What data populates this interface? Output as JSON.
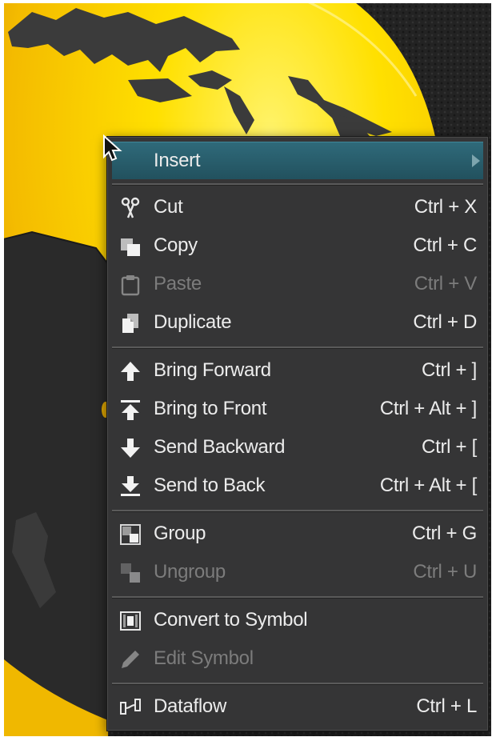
{
  "menu": {
    "insert": {
      "label": "Insert",
      "icon": "submenu-arrow-icon"
    },
    "cut": {
      "label": "Cut",
      "shortcut": "Ctrl + X",
      "icon": "scissors-icon"
    },
    "copy": {
      "label": "Copy",
      "shortcut": "Ctrl + C",
      "icon": "copy-icon"
    },
    "paste": {
      "label": "Paste",
      "shortcut": "Ctrl + V",
      "icon": "clipboard-icon",
      "disabled": true
    },
    "duplicate": {
      "label": "Duplicate",
      "shortcut": "Ctrl + D",
      "icon": "duplicate-icon"
    },
    "bring_forward": {
      "label": "Bring Forward",
      "shortcut": "Ctrl + ]",
      "icon": "arrow-up-icon"
    },
    "bring_to_front": {
      "label": "Bring to Front",
      "shortcut": "Ctrl + Alt + ]",
      "icon": "arrow-up-to-top-icon"
    },
    "send_backward": {
      "label": "Send Backward",
      "shortcut": "Ctrl + [",
      "icon": "arrow-down-icon"
    },
    "send_to_back": {
      "label": "Send to Back",
      "shortcut": "Ctrl + Alt + [",
      "icon": "arrow-down-to-bottom-icon"
    },
    "group": {
      "label": "Group",
      "shortcut": "Ctrl + G",
      "icon": "group-icon"
    },
    "ungroup": {
      "label": "Ungroup",
      "shortcut": "Ctrl + U",
      "icon": "ungroup-icon",
      "disabled": true
    },
    "convert_to_symbol": {
      "label": "Convert to Symbol",
      "icon": "symbol-icon"
    },
    "edit_symbol": {
      "label": "Edit Symbol",
      "icon": "pencil-icon",
      "disabled": true
    },
    "dataflow": {
      "label": "Dataflow",
      "shortcut": "Ctrl + L",
      "icon": "dataflow-icon"
    }
  },
  "colors": {
    "menu_bg": "#353536",
    "highlight": "#2f6a7a",
    "text": "#ececec",
    "disabled_text": "#7c7c7c",
    "globe_yellow": "#ffd200",
    "background": "#232323"
  }
}
